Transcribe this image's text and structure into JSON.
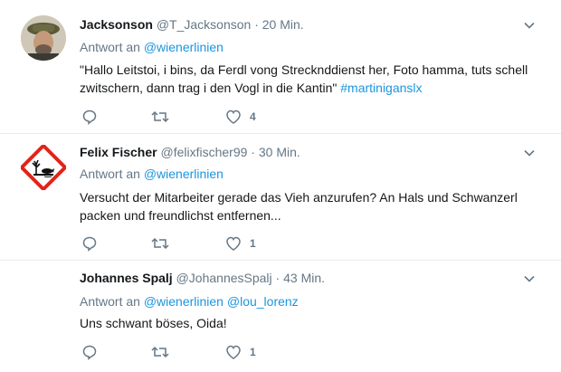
{
  "tweets": [
    {
      "name": "Jacksonson",
      "handle": "@T_Jacksonson",
      "separator": "·",
      "time": "20 Min.",
      "reply_prefix": "Antwort an",
      "mentions": [
        "@wienerlinien"
      ],
      "text": "\"Hallo Leitstoi, i bins, da Ferdl vong Strecknddienst her, Foto hamma, tuts schell zwitschern, dann trag i den Vogl in die Kantin\"",
      "hashtag": "#martiniganslx",
      "replies": "",
      "retweets": "",
      "likes": "4"
    },
    {
      "name": "Felix Fischer",
      "handle": "@felixfischer99",
      "separator": "·",
      "time": "30 Min.",
      "reply_prefix": "Antwort an",
      "mentions": [
        "@wienerlinien"
      ],
      "text": "Versucht der Mitarbeiter gerade das Vieh anzurufen? An Hals und Schwanzerl packen und freundlichst entfernen...",
      "hashtag": "",
      "replies": "",
      "retweets": "",
      "likes": "1"
    },
    {
      "name": "Johannes Spalj",
      "handle": "@JohannesSpalj",
      "separator": "·",
      "time": "43 Min.",
      "reply_prefix": "Antwort an",
      "mentions": [
        "@wienerlinien",
        "@lou_lorenz"
      ],
      "text": "Uns schwant böses, Oida!",
      "hashtag": "",
      "replies": "",
      "retweets": "",
      "likes": "1"
    }
  ],
  "icons": {
    "reply": "reply-icon",
    "retweet": "retweet-icon",
    "like": "heart-icon",
    "caret": "chevron-down-icon",
    "hazard": "environmental-hazard-icon"
  },
  "colors": {
    "link": "#1b95e0",
    "secondary": "#657786",
    "divider": "#e6ecf0",
    "hazard_red": "#e2231a"
  }
}
